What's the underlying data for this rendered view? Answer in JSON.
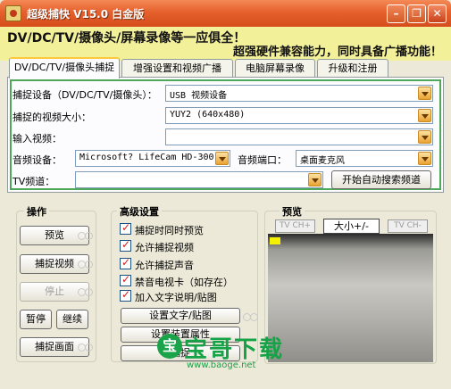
{
  "window": {
    "title": "超级捕快  V15.0  白金版",
    "minimize_icon": "minimize-icon",
    "maximize_icon": "restore-icon",
    "close_icon": "close-icon"
  },
  "banner": {
    "line1": "DV/DC/TV/摄像头/屏幕录像等一应俱全！",
    "line2": "超强硬件兼容能力，同时具备广播功能！"
  },
  "tabs": [
    {
      "label": "DV/DC/TV/摄像头捕捉",
      "active": true
    },
    {
      "label": "增强设置和视频广播",
      "active": false
    },
    {
      "label": "电脑屏幕录像",
      "active": false
    },
    {
      "label": "升级和注册",
      "active": false
    }
  ],
  "capture": {
    "device_label": "捕捉设备（DV/DC/TV/摄像头）：",
    "device_value": "USB 视频设备",
    "size_label": "捕捉的视频大小：",
    "size_value": "YUY2 (640x480)",
    "input_label": "输入视频：",
    "input_value": "",
    "audio_label": "音频设备：",
    "audio_value": "Microsoft? LifeCam HD-300",
    "audio_port_label": "音频端口：",
    "audio_port_value": "桌面麦克风",
    "tv_label": "TV频道：",
    "tv_value": "",
    "auto_search_button": "开始自动搜索频道"
  },
  "operate": {
    "title": "操作",
    "preview_button": "预览",
    "capture_video_button": "捕捉视频",
    "stop_button": "停止",
    "pause_button": "暂停",
    "continue_button": "继续",
    "capture_frame_button": "捕捉画面"
  },
  "advanced": {
    "title": "高级设置",
    "options": [
      {
        "label": "捕捉时同时预览",
        "checked": true
      },
      {
        "label": "允许捕捉视频",
        "checked": true
      },
      {
        "label": "允许捕捉声音",
        "checked": true
      },
      {
        "label": "禁音电视卡（如存在）",
        "checked": true
      },
      {
        "label": "加入文字说明/贴图",
        "checked": true
      }
    ],
    "text_overlay_button": "设置文字/贴图",
    "device_props_button": "设置装置属性",
    "capture_settings_button": "捕捉"
  },
  "preview": {
    "title": "预览",
    "tv_ch_plus": "TV CH+",
    "size_button": "大小+/-",
    "tv_ch_minus": "TV CH-"
  },
  "watermark": {
    "circle_text": "宝",
    "text": "宝哥下载",
    "url": "www.baoge.net"
  }
}
